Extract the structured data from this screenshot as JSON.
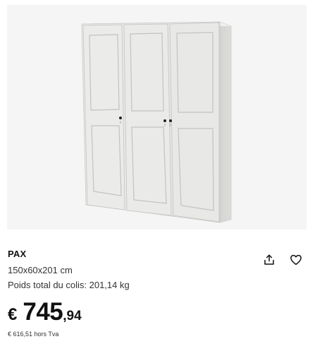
{
  "product": {
    "image_alt": "White three-door wardrobe with panel doors and black knobs",
    "name": "PAX",
    "dimensions": "150x60x201 cm",
    "weight": "Poids total du colis: 201,14 kg",
    "price": {
      "currency": "€",
      "integer": "745",
      "decimal": ",94"
    },
    "price_excl_tax": "€ 616,51 hors Tva"
  },
  "actions": {
    "share_icon": "share-icon",
    "favorite_icon": "heart-icon"
  },
  "colors": {
    "text": "#111111",
    "image_background": "#f5f5f5",
    "wardrobe": "#e9e9e7"
  }
}
